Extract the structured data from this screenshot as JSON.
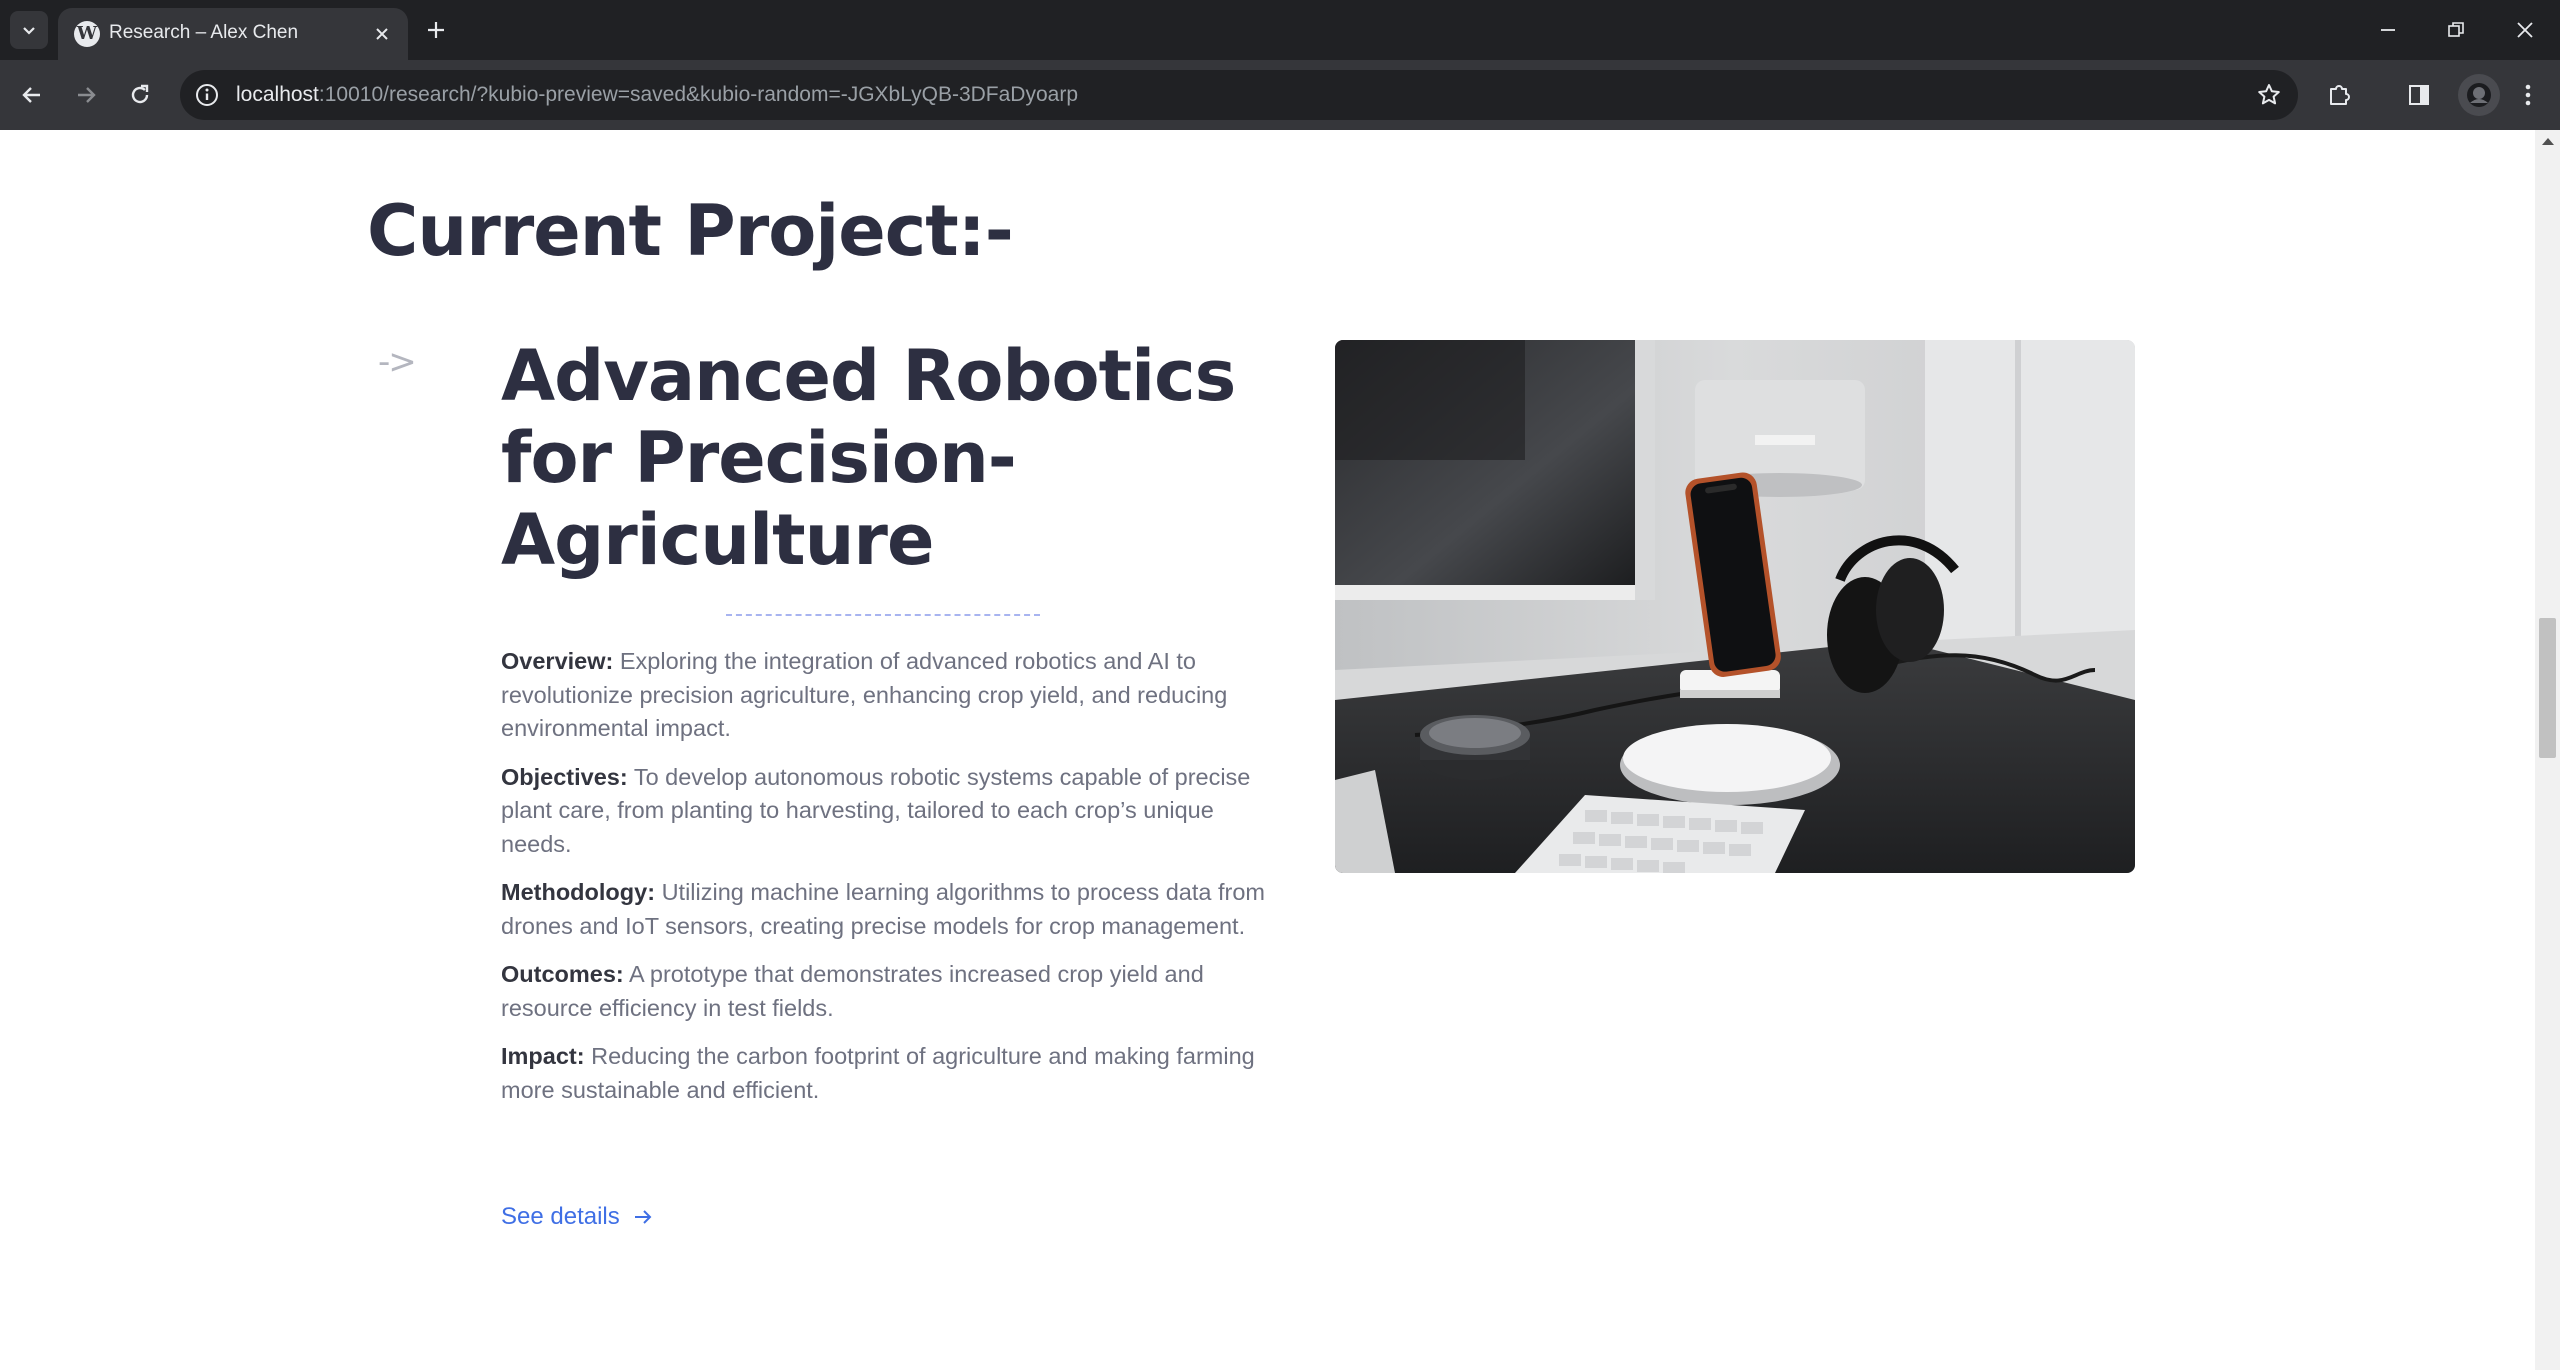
{
  "browser": {
    "tab": {
      "title": "Research – Alex Chen",
      "favicon": "wordpress-icon"
    },
    "omnibox": {
      "host": "localhost",
      "path": ":10010/research/?kubio-preview=saved&kubio-random=-JGXbLyQB-3DFaDyoarp"
    },
    "icons": [
      "tab-search-icon",
      "close-icon",
      "plus-icon",
      "minimize-icon",
      "restore-icon",
      "close-window-icon",
      "back-icon",
      "forward-icon",
      "reload-icon",
      "info-icon",
      "star-icon",
      "extensions-icon",
      "side-panel-icon",
      "profile-avatar",
      "kebab-menu-icon"
    ]
  },
  "page": {
    "section_title": "Current Project:-",
    "arrow": "->",
    "project_title": "Advanced Robotics for Precision-Agriculture",
    "items": [
      {
        "label": "Overview:",
        "text": "Exploring the integration of advanced robotics and AI to revolutionize precision agriculture, enhancing crop yield, and reducing environmental impact."
      },
      {
        "label": "Objectives:",
        "text": "To develop autonomous robotic systems capable of precise plant care, from planting to harvesting, tailored to each crop’s unique needs."
      },
      {
        "label": "Methodology:",
        "text": "Utilizing machine learning algorithms to process data from drones and IoT sensors, creating precise models for crop management."
      },
      {
        "label": "Outcomes:",
        "text": "A prototype that demonstrates increased crop yield and resource efficiency in test fields."
      },
      {
        "label": "Impact:",
        "text": "Reducing the carbon footprint of agriculture and making farming more sustainable and efficient."
      }
    ],
    "cta": {
      "label": "See details",
      "icon": "arrow-right-icon"
    },
    "image": {
      "subject": "desk-workspace-photo",
      "colors": {
        "accent": "#3f6fe5",
        "heading": "#2d2f41",
        "body": "#6e7180"
      }
    }
  }
}
